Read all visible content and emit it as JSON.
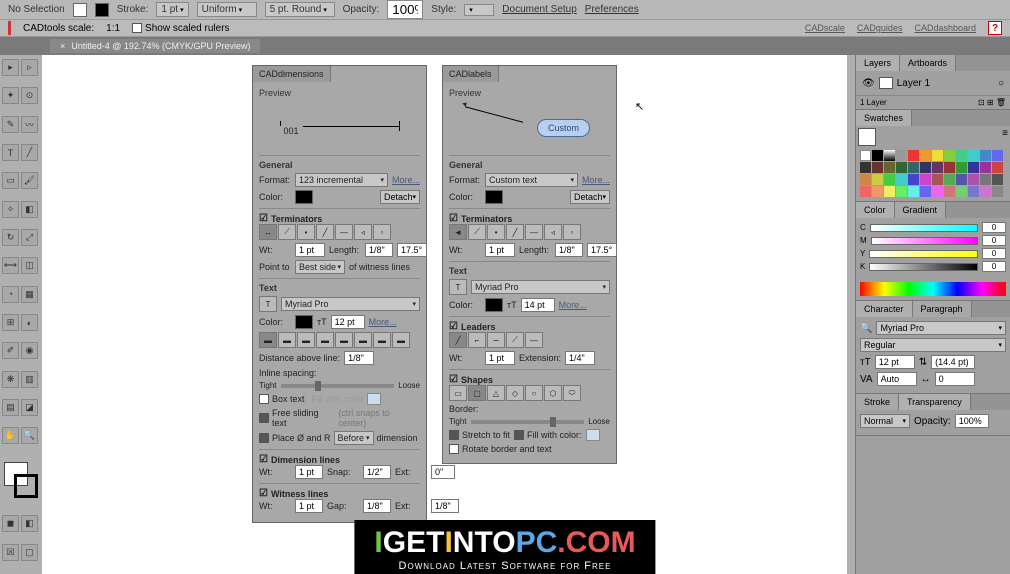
{
  "topbar": {
    "selection": "No Selection",
    "stroke_label": "Stroke:",
    "stroke_val": "1 pt",
    "uniform": "Uniform",
    "brush": "5 pt. Round",
    "opacity_label": "Opacity:",
    "opacity_val": "100%",
    "style_label": "Style:",
    "doc_setup": "Document Setup",
    "prefs": "Preferences"
  },
  "cadbar": {
    "scale_label": "CADtools scale:",
    "scale_val": "1:1",
    "rulers": "Show scaled rulers",
    "links": [
      "CADscale",
      "CADguides",
      "CADdashboard"
    ]
  },
  "doc_tab": "Untitled-4 @ 192.74% (CMYK/GPU Preview)",
  "dim_panel": {
    "title": "CADdimensions",
    "preview": "Preview",
    "preview_val": "001",
    "general": "General",
    "format_label": "Format:",
    "format_val": "123 incremental",
    "more": "More...",
    "color_label": "Color:",
    "detach": "Detach",
    "terminators": "Terminators",
    "wt_label": "Wt:",
    "wt_val": "1 pt",
    "length_label": "Length:",
    "length_val": "1/8\"",
    "angle_val": "17.5°",
    "point_label": "Point to",
    "point_val": "Best side",
    "witness": "of witness lines",
    "text": "Text",
    "font": "Myriad Pro",
    "size_val": "12 pt",
    "dist_label": "Distance above line:",
    "dist_val": "1/8\"",
    "spacing_label": "Inline spacing:",
    "tight": "Tight",
    "loose": "Loose",
    "box_text": "Box text",
    "fill_color": "Fill with color",
    "free_sliding": "Free sliding text",
    "snaps": "(ctrl snaps to center)",
    "place_label": "Place Ø and R",
    "place_val": "Before",
    "dimension": "dimension",
    "dim_lines": "Dimension lines",
    "snap_label": "Snap:",
    "snap_val": "1/2\"",
    "ext_label": "Ext:",
    "ext_val": "0\"",
    "witness_lines": "Witness lines",
    "gap_label": "Gap:",
    "gap_val": "1/8\"",
    "ext2_val": "1/8\""
  },
  "label_panel": {
    "title": "CADlabels",
    "preview": "Preview",
    "bubble": "Custom",
    "general": "General",
    "format_label": "Format:",
    "format_val": "Custom text",
    "more": "More...",
    "color_label": "Color:",
    "detach": "Detach",
    "terminators": "Terminators",
    "wt_val": "1 pt",
    "length_val": "1/8\"",
    "angle_val": "17.5°",
    "text": "Text",
    "font": "Myriad Pro",
    "size_val": "14 pt",
    "leaders": "Leaders",
    "ext_label": "Extension:",
    "ext_val": "1/4\"",
    "shapes": "Shapes",
    "border_label": "Border:",
    "tight": "Tight",
    "loose": "Loose",
    "stretch": "Stretch to fit",
    "fill": "Fill with color:",
    "rotate": "Rotate border and text"
  },
  "layers": {
    "tab1": "Layers",
    "tab2": "Artboards",
    "layer1": "Layer 1",
    "count": "1 Layer"
  },
  "swatches": {
    "tab": "Swatches"
  },
  "color": {
    "tab1": "Color",
    "tab2": "Gradient",
    "c": "C",
    "m": "M",
    "y": "Y",
    "k": "K",
    "val": "0"
  },
  "character": {
    "tab1": "Character",
    "tab2": "Paragraph",
    "font": "Myriad Pro",
    "style": "Regular",
    "size": "12 pt",
    "leading": "(14.4 pt)",
    "va": "Auto",
    "tracking": "0"
  },
  "stroke_panel": {
    "tab1": "Stroke",
    "tab2": "Transparency",
    "mode": "Normal",
    "opacity_label": "Opacity:",
    "opacity": "100%"
  },
  "watermark": {
    "title_parts": [
      "I",
      "G",
      "ET",
      "I",
      "NTO",
      "PC",
      ".COM"
    ],
    "sub": "Download Latest Software for Free"
  }
}
